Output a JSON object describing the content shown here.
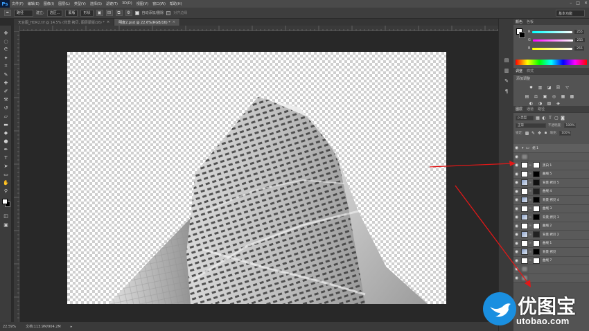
{
  "app": {
    "logo": "Ps"
  },
  "menu": [
    "文件(F)",
    "编辑(E)",
    "图像(I)",
    "图层(L)",
    "类型(Y)",
    "选择(S)",
    "滤镜(T)",
    "3D(D)",
    "视图(V)",
    "窗口(W)",
    "帮助(H)"
  ],
  "options": {
    "mode_select": "路径",
    "label_make": "建立:",
    "btn_selection": "选区...",
    "btn_mask": "蒙版",
    "btn_shape": "形状",
    "auto_add_delete": "自动添加/删除",
    "align_edges": "对齐边缘",
    "workspace": "基本功能"
  },
  "tabs": [
    {
      "label": "天台图_HDR2.tif @ 14.5% (背景 拷贝, 图层蒙版/16) *",
      "active": false
    },
    {
      "label": "明度2.psd @ 22.6%(RGB/16) *",
      "active": true
    }
  ],
  "status": {
    "zoom": "22.59%",
    "doc": "文档:113.9M/904.2M"
  },
  "color_panel": {
    "tabs": [
      "颜色",
      "色板"
    ],
    "channels": [
      {
        "label": "R",
        "value": "255",
        "gradient": "#ff4040"
      },
      {
        "label": "G",
        "value": "255",
        "gradient": "#40ff40"
      },
      {
        "label": "B",
        "value": "255",
        "gradient": "#4040ff"
      }
    ]
  },
  "adjust_panel": {
    "tabs": [
      "调整",
      "样式"
    ],
    "title": "添加调整"
  },
  "layers_panel": {
    "tabs": [
      "图层",
      "通道",
      "路径"
    ],
    "kind_select": "ρ 类型",
    "blend_select": "正常",
    "opacity_label": "不透明度:",
    "opacity_value": "100%",
    "lock_label": "锁定:",
    "fill_label": "填充:",
    "fill_value": "100%",
    "layers": [
      {
        "name": "组 1",
        "type": "group",
        "mask": ""
      },
      {
        "name": "",
        "type": "blurred",
        "mask": ""
      },
      {
        "name": "黑白 1",
        "type": "adjust",
        "mask": "#ffffff"
      },
      {
        "name": "曲线 5",
        "type": "adjust",
        "mask": "#000000"
      },
      {
        "name": "背景 拷贝 5",
        "type": "image",
        "mask": "#111111"
      },
      {
        "name": "曲线 4",
        "type": "adjust",
        "mask": "#222222"
      },
      {
        "name": "背景 拷贝 4",
        "type": "image",
        "mask": "#000000"
      },
      {
        "name": "曲线 3",
        "type": "adjust",
        "mask": "#ffffff"
      },
      {
        "name": "背景 拷贝 3",
        "type": "image",
        "mask": "#000000"
      },
      {
        "name": "曲线 2",
        "type": "adjust",
        "mask": "#ffffff"
      },
      {
        "name": "背景 拷贝 2",
        "type": "image",
        "mask": "#222222"
      },
      {
        "name": "曲线 1",
        "type": "adjust",
        "mask": "#ffffff"
      },
      {
        "name": "背景 拷贝",
        "type": "image",
        "mask": "#000000"
      },
      {
        "name": "曲线 7",
        "type": "adjust",
        "mask": "#ffffff"
      },
      {
        "name": "",
        "type": "blurred",
        "mask": ""
      },
      {
        "name": "",
        "type": "blurred",
        "mask": ""
      }
    ]
  },
  "watermark": {
    "brand": "优图宝",
    "url": "utobao.com"
  },
  "colors": {
    "annotation": "#e21818",
    "accent": "#1a8fe0"
  }
}
